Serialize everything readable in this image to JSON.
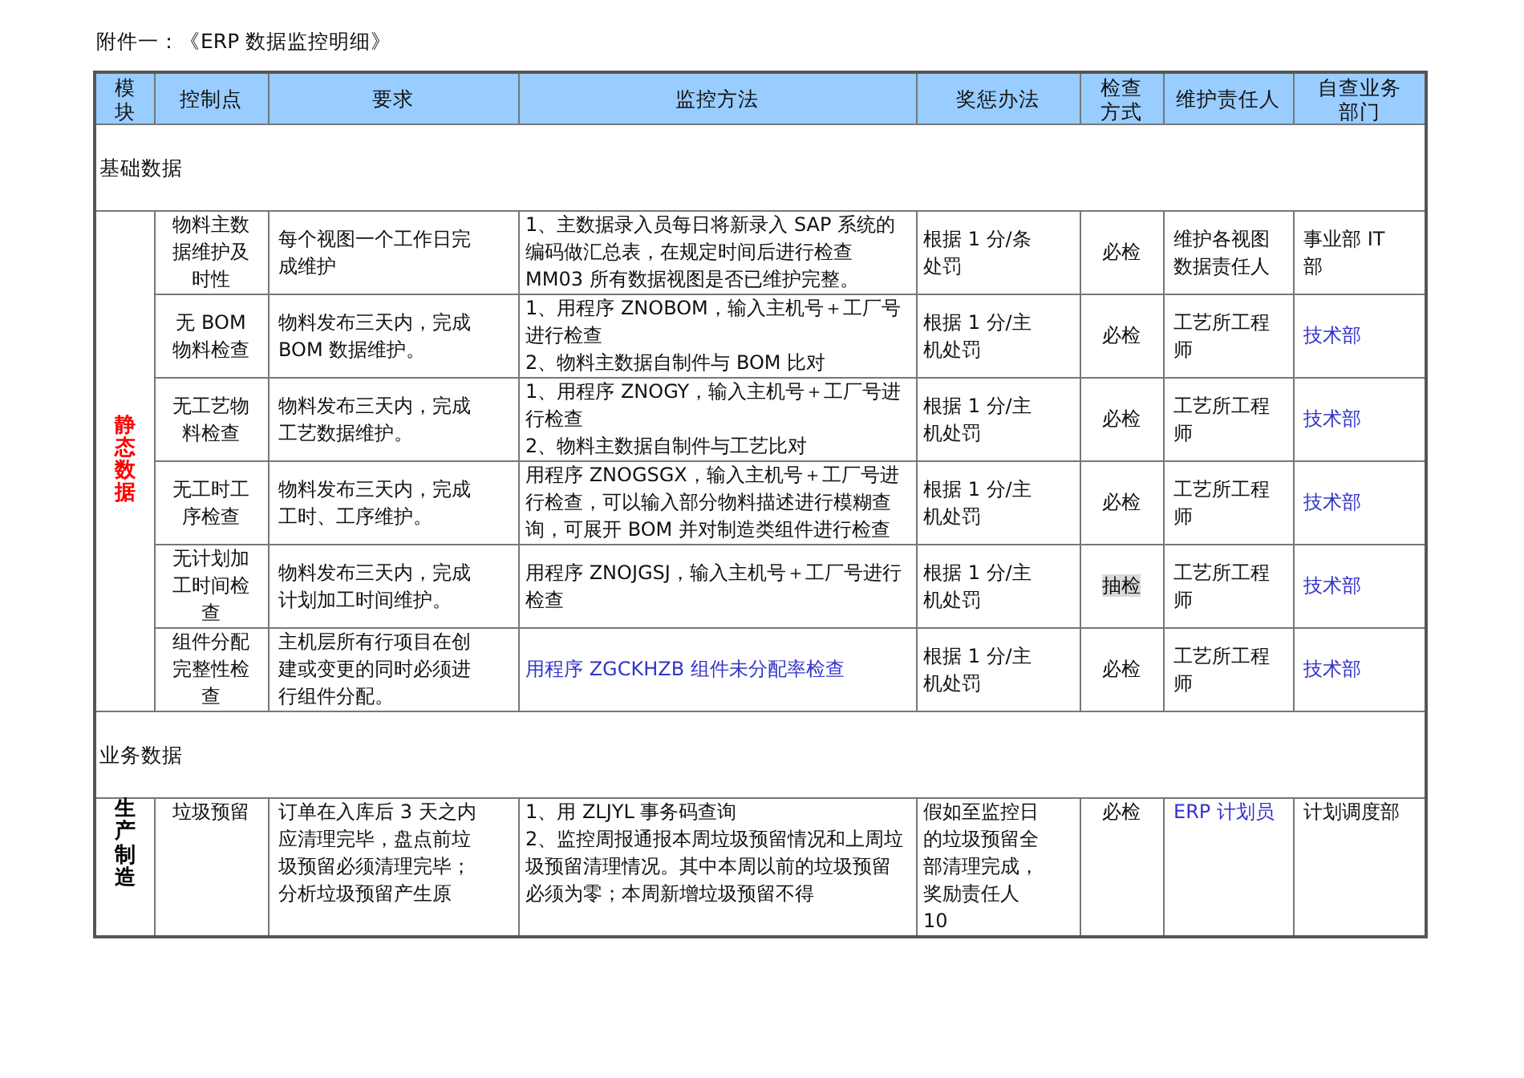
{
  "title": "附件一：《ERP 数据监控明细》",
  "columns": [
    "模块",
    "控制点",
    "要求",
    "监控方法",
    "奖惩办法",
    "检查方式",
    "维护责任人",
    "自查业务部门"
  ],
  "sections": [
    {
      "title": "基础数据",
      "groups": [
        {
          "module": {
            "text": "静态数据",
            "color": "#ff0000"
          },
          "rows": [
            {
              "control": "物料主数据维护及时性",
              "requirement": "每个视图一个工作日完成维护",
              "method": {
                "text": "1、主数据录入员每日将新录入 SAP 系统的编码做汇总表，在规定时间后进行检查 MM03 所有数据视图是否已维护完整。",
                "accent": false
              },
              "penalty": "根据 1 分/条处罚",
              "check": {
                "text": "必检",
                "highlighted": false
              },
              "owner": {
                "text": "维护各视图数据责任人",
                "accent": false
              },
              "dept": {
                "text": "事业部 IT 部",
                "accent": false
              }
            },
            {
              "control": "无 BOM 物料检查",
              "requirement": "物料发布三天内，完成 BOM 数据维护。",
              "method": {
                "text": "1、用程序 ZNOBOM，输入主机号＋工厂号进行检查\n2、物料主数据自制件与 BOM 比对",
                "accent": false
              },
              "penalty": "根据 1 分/主机处罚",
              "check": {
                "text": "必检",
                "highlighted": false
              },
              "owner": {
                "text": "工艺所工程师",
                "accent": false
              },
              "dept": {
                "text": "技术部",
                "accent": true
              }
            },
            {
              "control": "无工艺物料检查",
              "requirement": "物料发布三天内，完成工艺数据维护。",
              "method": {
                "text": "1、用程序 ZNOGY，输入主机号＋工厂号进行检查\n2、物料主数据自制件与工艺比对",
                "accent": false
              },
              "penalty": "根据 1 分/主机处罚",
              "check": {
                "text": "必检",
                "highlighted": false
              },
              "owner": {
                "text": "工艺所工程师",
                "accent": false
              },
              "dept": {
                "text": "技术部",
                "accent": true
              }
            },
            {
              "control": "无工时工序检查",
              "requirement": "物料发布三天内，完成工时、工序维护。",
              "method": {
                "text": "用程序 ZNOGSGX，输入主机号＋工厂号进行检查，可以输入部分物料描述进行模糊查询，可展开 BOM 并对制造类组件进行检查",
                "accent": false
              },
              "penalty": "根据 1 分/主机处罚",
              "check": {
                "text": "必检",
                "highlighted": false
              },
              "owner": {
                "text": "工艺所工程师",
                "accent": false
              },
              "dept": {
                "text": "技术部",
                "accent": true
              }
            },
            {
              "control": "无计划加工时间检查",
              "requirement": "物料发布三天内，完成计划加工时间维护。",
              "method": {
                "text": "用程序 ZNOJGSJ，输入主机号＋工厂号进行检查",
                "accent": false
              },
              "penalty": "根据 1 分/主机处罚",
              "check": {
                "text": "抽检",
                "highlighted": true
              },
              "owner": {
                "text": "工艺所工程师",
                "accent": false
              },
              "dept": {
                "text": "技术部",
                "accent": true
              }
            },
            {
              "control": "组件分配完整性检查",
              "requirement": "主机层所有行项目在创建或变更的同时必须进行组件分配。",
              "method": {
                "text": "用程序 ZGCKHZB 组件未分配率检查",
                "accent": true
              },
              "penalty": "根据 1 分/主机处罚",
              "check": {
                "text": "必检",
                "highlighted": false
              },
              "owner": {
                "text": "工艺所工程师",
                "accent": false
              },
              "dept": {
                "text": "技术部",
                "accent": true
              }
            }
          ]
        }
      ]
    },
    {
      "title": "业务数据",
      "groups": [
        {
          "module": {
            "text": "生产制造",
            "color": "#000000"
          },
          "rows": [
            {
              "control": "垃圾预留",
              "requirement": "订单在入库后 3 天之内应清理完毕，盘点前垃圾预留必须清理完毕；分析垃圾预留产生原",
              "method": {
                "text": "1、用 ZLJYL 事务码查询\n2、监控周报通报本周垃圾预留情况和上周垃圾预留清理情况。其中本周以前的垃圾预留必须为零；本周新增垃圾预留不得",
                "accent": false
              },
              "penalty": "假如至监控日的垃圾预留全部清理完成，奖励责任人 10",
              "check": {
                "text": "必检",
                "highlighted": false
              },
              "owner": {
                "text": "ERP 计划员",
                "accent": true
              },
              "dept": {
                "text": "计划调度部",
                "accent": false
              }
            }
          ]
        }
      ]
    }
  ]
}
